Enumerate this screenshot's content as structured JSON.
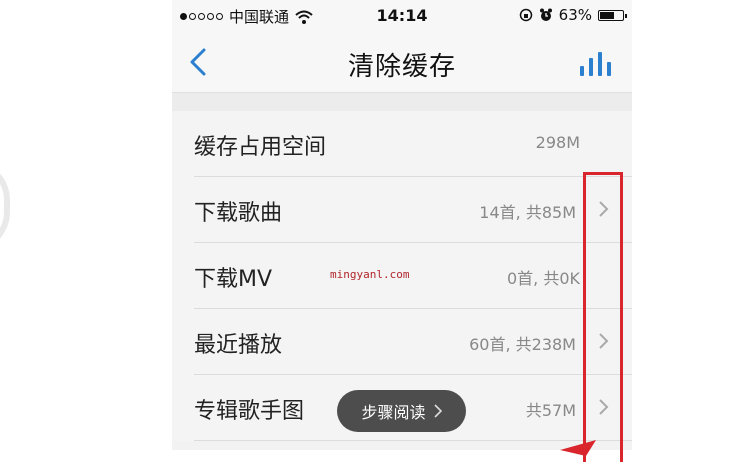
{
  "status_bar": {
    "carrier": "中国联通",
    "time": "14:14",
    "battery": "63%",
    "battery_level": 0.63
  },
  "nav": {
    "title": "清除缓存",
    "back_icon": "chevron-left-icon",
    "right_icon": "bar-chart-icon"
  },
  "rows": [
    {
      "label": "缓存占用空间",
      "value": "298M",
      "has_arrow": false
    },
    {
      "label": "下载歌曲",
      "value": "14首, 共85M",
      "has_arrow": true
    },
    {
      "label": "下载MV",
      "value": "0首, 共0K",
      "has_arrow": false
    },
    {
      "label": "最近播放",
      "value": "60首, 共238M",
      "has_arrow": true
    },
    {
      "label": "专辑歌手图",
      "value": "共57M",
      "has_arrow": true
    }
  ],
  "watermark": "mingyanl.com",
  "step_button": {
    "label": "步骤阅读",
    "icon": "chevron-right-icon"
  },
  "colors": {
    "accent_blue": "#2b7fcf",
    "highlight_red": "#d8262c"
  }
}
